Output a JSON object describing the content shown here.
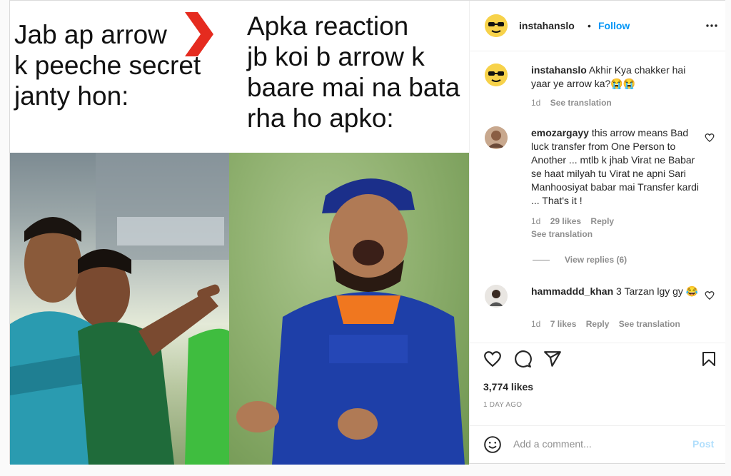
{
  "meme": {
    "left_caption": "Jab ap arrow\nk peeche secret\njanty hon:",
    "right_caption": "Apka reaction\njb koi b arrow k\nbaare mai na bata\nrha ho apko:",
    "arrow_color": "#e52b1f"
  },
  "header": {
    "username": "instahanslo",
    "separator": "•",
    "follow_label": "Follow",
    "more_icon": "more-horizontal-icon"
  },
  "comments": [
    {
      "username": "instahanslo",
      "text": "Akhir Kya chakker hai yaar ye arrow ka?😭😭",
      "time": "1d",
      "see_translation": "See translation"
    },
    {
      "username": "emozargayy",
      "text": "this arrow means Bad luck transfer from One Person to Another ... mtlb k jhab Virat ne Babar se haat milyah tu Virat ne apni Sari Manhoosiyat babar mai Transfer kardi ... That's it !",
      "time": "1d",
      "likes": "29 likes",
      "reply": "Reply",
      "see_translation": "See translation",
      "view_replies": "View replies (6)"
    },
    {
      "username": "hammaddd_khan",
      "text": "3 Tarzan lgy gy 😂",
      "time": "1d",
      "likes": "7 likes",
      "reply": "Reply",
      "see_translation": "See translation"
    }
  ],
  "actions": {
    "likes": "3,774 likes",
    "date": "1 DAY AGO",
    "icons": [
      "heart-icon",
      "comment-icon",
      "share-icon",
      "bookmark-icon"
    ]
  },
  "add_comment": {
    "placeholder": "Add a comment...",
    "post_label": "Post",
    "emoji_icon": "emoji-icon"
  },
  "colors": {
    "link": "#0095f6",
    "muted": "#8e8e8e",
    "text": "#262626",
    "post_disabled": "#b2dffc"
  }
}
